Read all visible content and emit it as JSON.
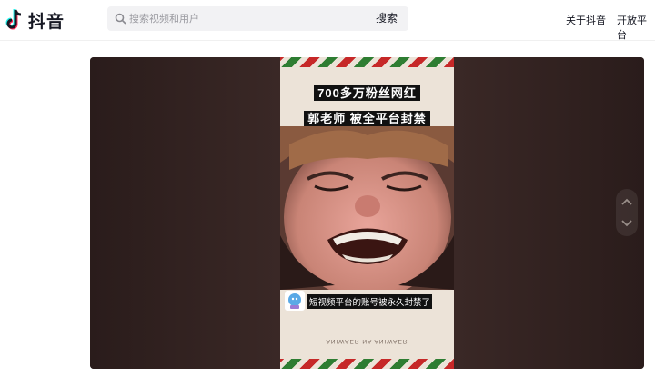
{
  "header": {
    "logo_text": "抖音",
    "search": {
      "placeholder": "搜索视频和用户",
      "button_label": "搜索"
    },
    "nav": [
      {
        "label": "关于抖音"
      },
      {
        "label": "开放平台"
      }
    ]
  },
  "video": {
    "title_line1": "700多万粉丝网红",
    "title_line2": "郭老师 被全平台封禁",
    "subtitle": "短视频平台的账号被永久封禁了",
    "mirrored_caption": "ANIWAER NA ANIWAER"
  },
  "colors": {
    "accent_red": "#c62828",
    "accent_green": "#2e7d32",
    "logo_cyan": "#25f4ee",
    "logo_pink": "#fe2c55",
    "player_bg": "#2b1e1c"
  },
  "icons": {
    "logo": "tiktok-note-icon",
    "search": "search-icon",
    "prev": "chevron-up-icon",
    "next": "chevron-down-icon"
  }
}
